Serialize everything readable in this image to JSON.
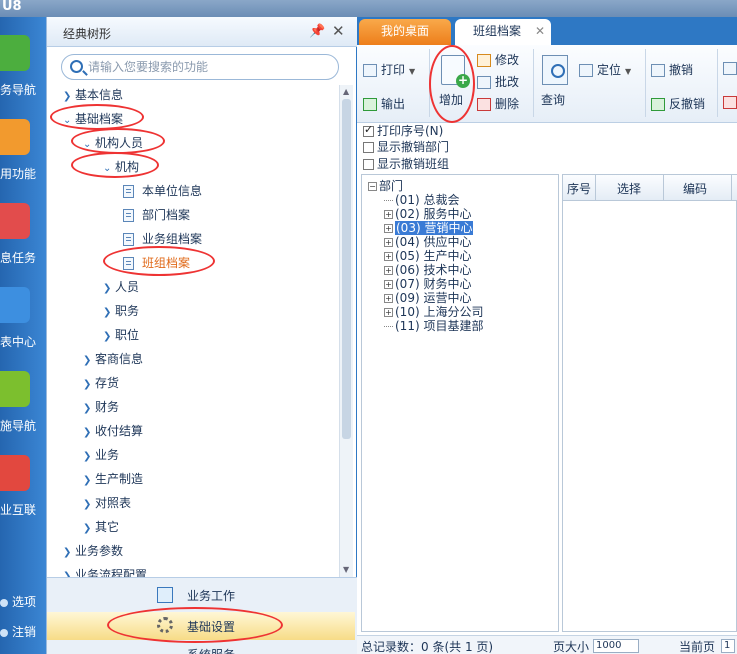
{
  "app": {
    "logo_text": "U8"
  },
  "leftnav": {
    "items": [
      {
        "label": "务导航",
        "icon": "business-nav-icon",
        "color": "#4cae3e"
      },
      {
        "label": "用功能",
        "icon": "star-icon",
        "color": "#f29a2e"
      },
      {
        "label": "息任务",
        "icon": "mail-icon",
        "color": "#e24c4c"
      },
      {
        "label": "表中心",
        "icon": "report-icon",
        "color": "#3d8fe0"
      },
      {
        "label": "施导航",
        "icon": "compass-icon",
        "color": "#7cbf2e"
      },
      {
        "label": "业互联",
        "icon": "network-icon",
        "color": "#e2483f"
      }
    ],
    "footer": {
      "options": "选项",
      "logout": "注销"
    }
  },
  "tree_panel": {
    "title": "经典树形",
    "search_placeholder": "请输入您要搜索的功能",
    "nodes": [
      {
        "label": "基本信息",
        "level": 1,
        "expanded": false
      },
      {
        "label": "基础档案",
        "level": 1,
        "expanded": true
      },
      {
        "label": "机构人员",
        "level": 2,
        "expanded": true
      },
      {
        "label": "机构",
        "level": 3,
        "expanded": true
      },
      {
        "label": "本单位信息",
        "level": 4,
        "leaf": true
      },
      {
        "label": "部门档案",
        "level": 4,
        "leaf": true
      },
      {
        "label": "业务组档案",
        "level": 4,
        "leaf": true
      },
      {
        "label": "班组档案",
        "level": 4,
        "leaf": true,
        "active": true
      },
      {
        "label": "人员",
        "level": 3,
        "expanded": false
      },
      {
        "label": "职务",
        "level": 3,
        "expanded": false
      },
      {
        "label": "职位",
        "level": 3,
        "expanded": false
      },
      {
        "label": "客商信息",
        "level": 2,
        "expanded": false
      },
      {
        "label": "存货",
        "level": 2,
        "expanded": false
      },
      {
        "label": "财务",
        "level": 2,
        "expanded": false
      },
      {
        "label": "收付结算",
        "level": 2,
        "expanded": false
      },
      {
        "label": "业务",
        "level": 2,
        "expanded": false
      },
      {
        "label": "生产制造",
        "level": 2,
        "expanded": false
      },
      {
        "label": "对照表",
        "level": 2,
        "expanded": false
      },
      {
        "label": "其它",
        "level": 2,
        "expanded": false
      },
      {
        "label": "业务参数",
        "level": 1,
        "expanded": false
      },
      {
        "label": "业务流程配置",
        "level": 1,
        "expanded": false
      }
    ],
    "bottom": {
      "business_work": "业务工作",
      "basic_settings": "基础设置",
      "system_service": "系统服务"
    }
  },
  "tabs": {
    "desktop": "我的桌面",
    "current": "班组档案"
  },
  "toolbar": {
    "print": "打印",
    "output": "输出",
    "add": "增加",
    "modify": "修改",
    "batch_modify": "批改",
    "delete": "删除",
    "query": "查询",
    "locate": "定位",
    "revoke": "撤销",
    "unrevoke": "反撤销"
  },
  "options": {
    "print_seq": "打印序号(N)",
    "show_revoked_dept": "显示撤销部门",
    "show_revoked_team": "显示撤销班组"
  },
  "dept_tree": {
    "root": "部门",
    "items": [
      {
        "code": "(01)",
        "name": "总裁会",
        "expandable": false
      },
      {
        "code": "(02)",
        "name": "服务中心",
        "expandable": true
      },
      {
        "code": "(03)",
        "name": "营销中心",
        "expandable": true,
        "selected": true
      },
      {
        "code": "(04)",
        "name": "供应中心",
        "expandable": true
      },
      {
        "code": "(05)",
        "name": "生产中心",
        "expandable": true
      },
      {
        "code": "(06)",
        "name": "技术中心",
        "expandable": true
      },
      {
        "code": "(07)",
        "name": "财务中心",
        "expandable": true
      },
      {
        "code": "(09)",
        "name": "运营中心",
        "expandable": true
      },
      {
        "code": "(10)",
        "name": "上海分公司",
        "expandable": true
      },
      {
        "code": "(11)",
        "name": "项目基建部",
        "expandable": false
      }
    ]
  },
  "grid": {
    "columns": [
      "序号",
      "选择",
      "编码"
    ]
  },
  "statusbar": {
    "total_records": "总记录数：0 条(共 1 页)",
    "page_size_label": "页大小",
    "page_size_value": "1000",
    "current_page_label": "当前页",
    "current_page_value": "1"
  }
}
